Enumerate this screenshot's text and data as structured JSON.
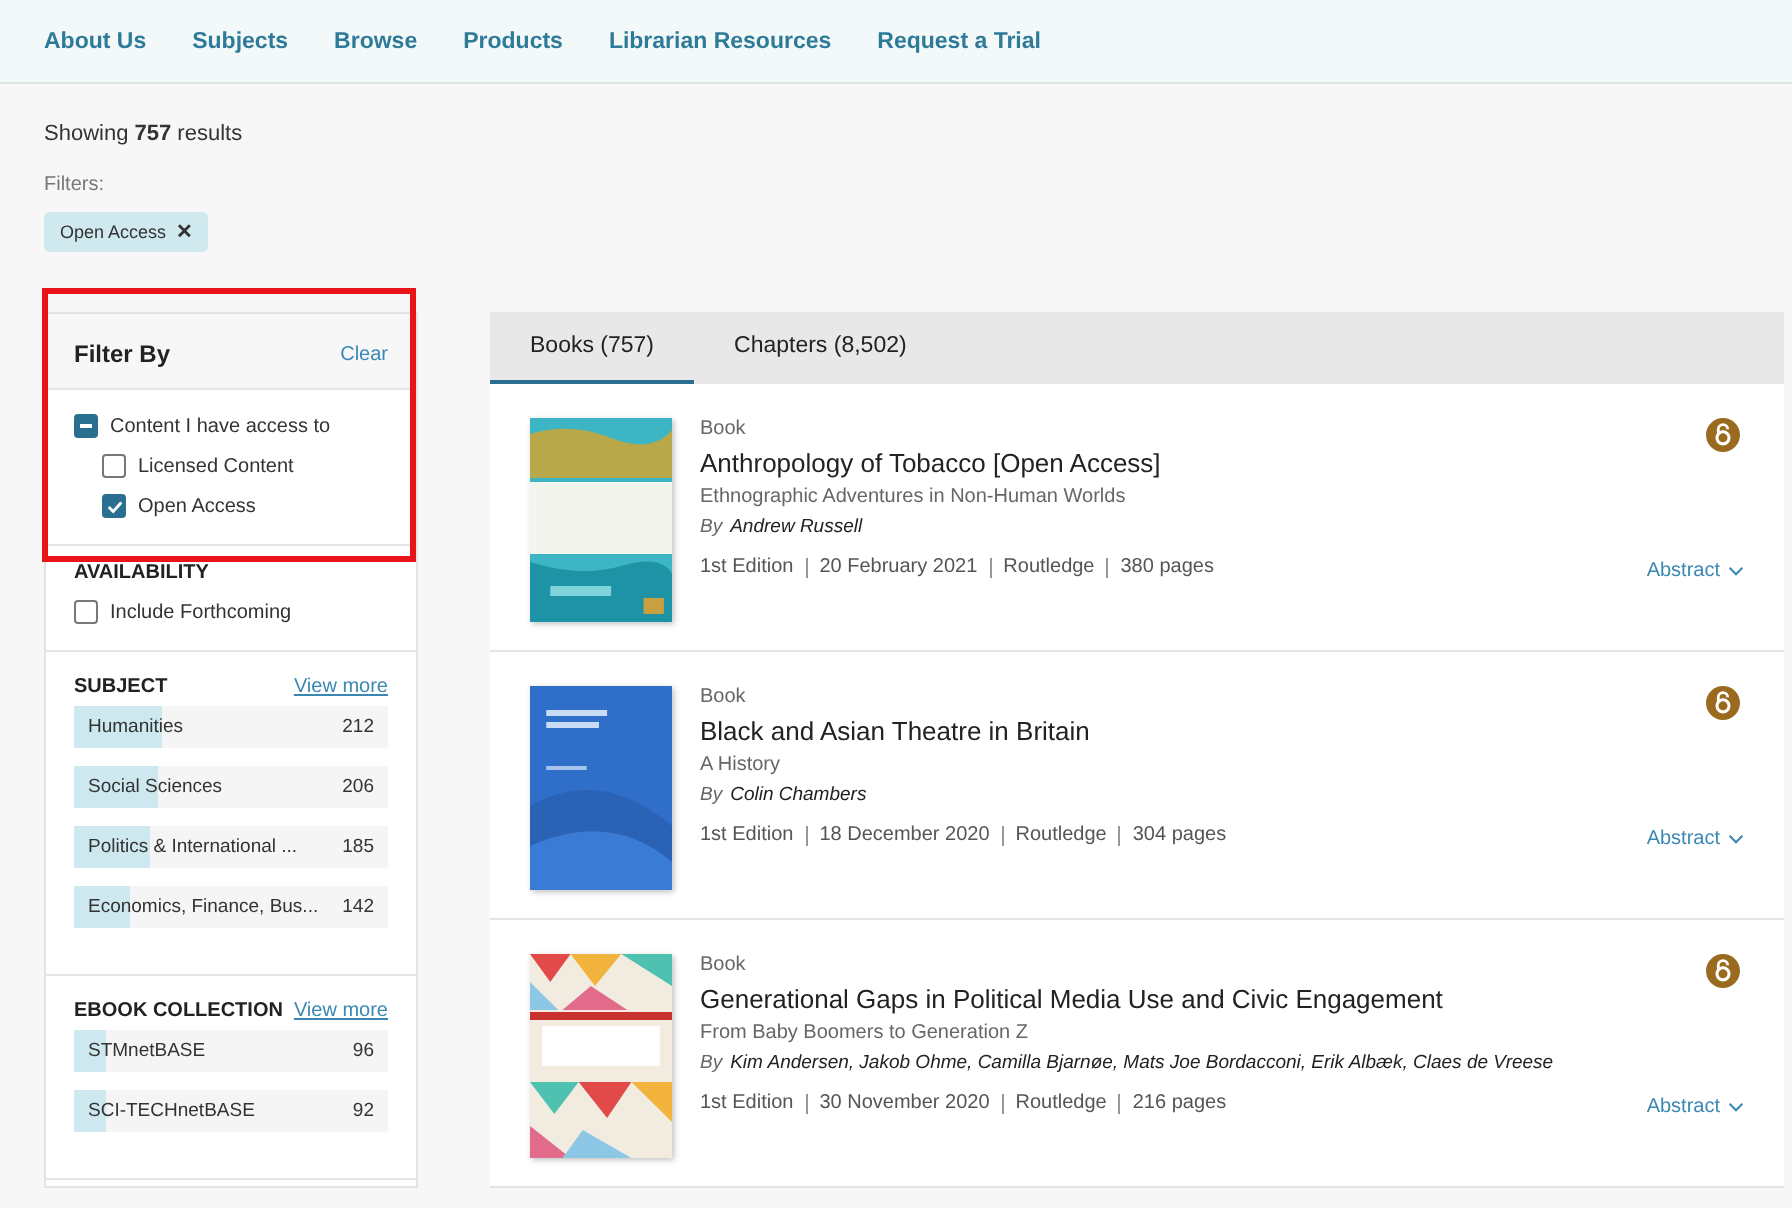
{
  "nav": [
    {
      "label": "About Us"
    },
    {
      "label": "Subjects"
    },
    {
      "label": "Browse"
    },
    {
      "label": "Products"
    },
    {
      "label": "Librarian Resources"
    },
    {
      "label": "Request a Trial"
    }
  ],
  "results_summary": {
    "prefix": "Showing",
    "count": "757",
    "suffix": "results"
  },
  "filters": {
    "label": "Filters:",
    "chips": [
      {
        "label": "Open Access",
        "remove": "✕"
      }
    ]
  },
  "filter_by": {
    "title": "Filter By",
    "clear": "Clear",
    "access": {
      "label": "Content I have access to",
      "checked": true,
      "indeterminate": true,
      "children": [
        {
          "label": "Licensed Content",
          "checked": false
        },
        {
          "label": "Open Access",
          "checked": true
        }
      ]
    }
  },
  "availability": {
    "title": "AVAILABILITY",
    "options": [
      {
        "label": "Include Forthcoming",
        "checked": false
      }
    ]
  },
  "facets": [
    {
      "title": "SUBJECT",
      "more": "View more",
      "items": [
        {
          "label": "Humanities",
          "count": "212",
          "level": 0.28
        },
        {
          "label": "Social Sciences",
          "count": "206",
          "level": 0.27
        },
        {
          "label": "Politics & International ...",
          "count": "185",
          "level": 0.24
        },
        {
          "label": "Economics, Finance, Bus...",
          "count": "142",
          "level": 0.18
        }
      ]
    },
    {
      "title": "EBOOK COLLECTION",
      "more": "View more",
      "items": [
        {
          "label": "STMnetBASE",
          "count": "96",
          "level": 0.1
        },
        {
          "label": "SCI-TECHnetBASE",
          "count": "92",
          "level": 0.1
        }
      ]
    }
  ],
  "tabs": [
    {
      "label": "Books  (757)",
      "selected": true
    },
    {
      "label": "Chapters  (8,502)",
      "selected": false
    }
  ],
  "results": [
    {
      "type": "Book",
      "title": "Anthropology of Tobacco [Open Access]",
      "subtitle": "Ethnographic Adventures in Non-Human Worlds",
      "by": "By",
      "authors": "Andrew Russell",
      "meta": [
        "1st Edition",
        "20 February 2021",
        "Routledge",
        "380 pages"
      ],
      "abstract": "Abstract"
    },
    {
      "type": "Book",
      "title": "Black and Asian Theatre in Britain",
      "subtitle": "A History",
      "by": "By",
      "authors": "Colin Chambers",
      "meta": [
        "1st Edition",
        "18 December 2020",
        "Routledge",
        "304 pages"
      ],
      "abstract": "Abstract"
    },
    {
      "type": "Book",
      "title": "Generational Gaps in Political Media Use and Civic Engagement",
      "subtitle": "From Baby Boomers to Generation Z",
      "by": "By",
      "authors": "Kim Andersen, Jakob Ohme, Camilla Bjarnøe, Mats Joe Bordacconi, Erik Albæk, Claes de Vreese",
      "meta": [
        "1st Edition",
        "30 November 2020",
        "Routledge",
        "216 pages"
      ],
      "abstract": "Abstract"
    }
  ]
}
